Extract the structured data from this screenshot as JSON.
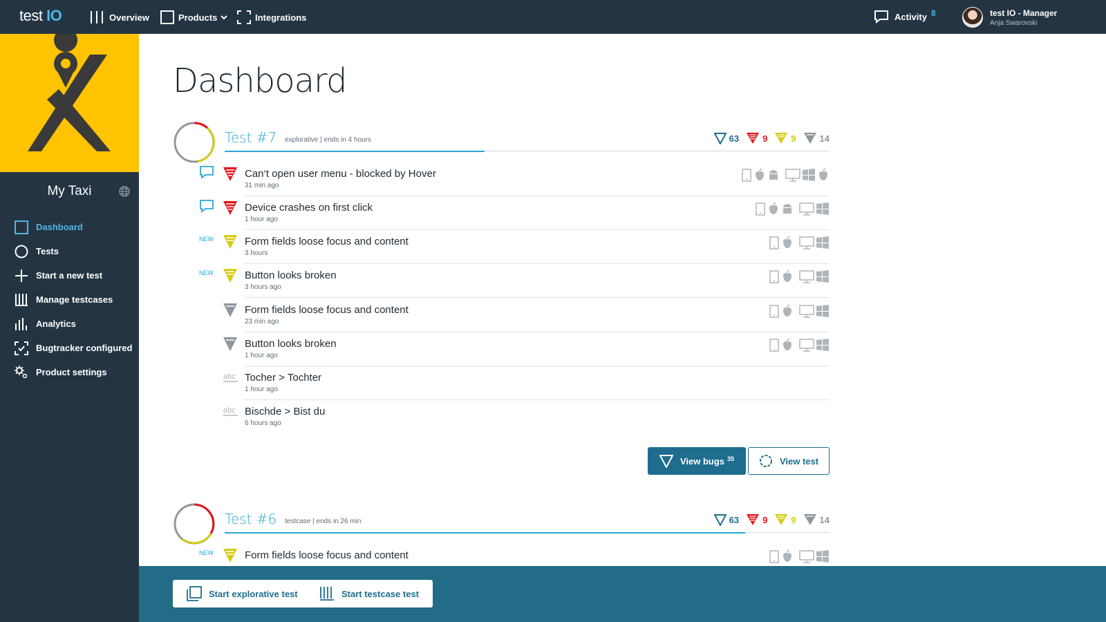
{
  "brand": {
    "logo_main": "test",
    "logo_accent": "IO"
  },
  "nav": {
    "overview": "Overview",
    "products": "Products",
    "integrations": "Integrations",
    "activity_label": "Activity",
    "activity_count": "8"
  },
  "user": {
    "name": "test IO - Manager",
    "subtitle": "Anja Swarovski"
  },
  "sidebar": {
    "product_name": "My Taxi",
    "items": [
      {
        "label": "Dashboard",
        "icon": "square-icon",
        "active": true
      },
      {
        "label": "Tests",
        "icon": "circle-icon"
      },
      {
        "label": "Start a new test",
        "icon": "plus-icon"
      },
      {
        "label": "Manage testcases",
        "icon": "bars-icon"
      },
      {
        "label": "Analytics",
        "icon": "chart-icon"
      },
      {
        "label": "Bugtracker configured",
        "icon": "bugtracker-icon"
      },
      {
        "label": "Product settings",
        "icon": "gears-icon"
      }
    ]
  },
  "page_title": "Dashboard",
  "tests": [
    {
      "title": "Test #7",
      "meta": "explorative | ends in 4 hours",
      "progress_fraction": 0.43,
      "counters": {
        "total": "63",
        "critical": "9",
        "high": "9",
        "low": "14"
      },
      "bugs": [
        {
          "title": "Can‘t open user menu - blocked by Hover",
          "time": "31 min ago",
          "badge": "",
          "severity": "critical",
          "comment": true
        },
        {
          "title": "Device crashes on first click",
          "time": "1 hour ago",
          "badge": "",
          "severity": "critical",
          "comment": true
        },
        {
          "title": "Form fields loose focus and content",
          "time": "3 hours",
          "badge": "NEW",
          "severity": "high"
        },
        {
          "title": "Button looks broken",
          "time": "3 hours ago",
          "badge": "NEW",
          "severity": "high"
        },
        {
          "title": "Form fields loose focus and content",
          "time": "23 min ago",
          "badge": "",
          "severity": "low"
        },
        {
          "title": "Button looks broken",
          "time": "1 hour ago",
          "badge": "",
          "severity": "low"
        },
        {
          "title": "Tocher > Tochter",
          "time": "1 hour ago",
          "badge": "",
          "severity": "content"
        },
        {
          "title": "Bischde > Bist du",
          "time": "6 hours ago",
          "badge": "",
          "severity": "content"
        }
      ],
      "view_bugs_label": "View bugs",
      "view_bugs_count": "35",
      "view_test_label": "View test"
    },
    {
      "title": "Test #6",
      "meta": "testcase | ends in 26 min",
      "progress_fraction": 0.86,
      "counters": {
        "total": "63",
        "critical": "9",
        "high": "9",
        "low": "14"
      },
      "bugs": [
        {
          "title": "Form fields loose focus and content",
          "time": "",
          "badge": "NEW",
          "severity": "high"
        }
      ]
    }
  ],
  "bottom": {
    "start_explorative": "Start explorative test",
    "start_testcase": "Start testcase test"
  },
  "colors": {
    "critical": "#e3141b",
    "high": "#d4cc12",
    "low": "#8e979d",
    "accent": "#2ba6d6",
    "primary": "#1e6d8e",
    "sidebar": "#243442",
    "logo_bg": "#ffc300"
  }
}
